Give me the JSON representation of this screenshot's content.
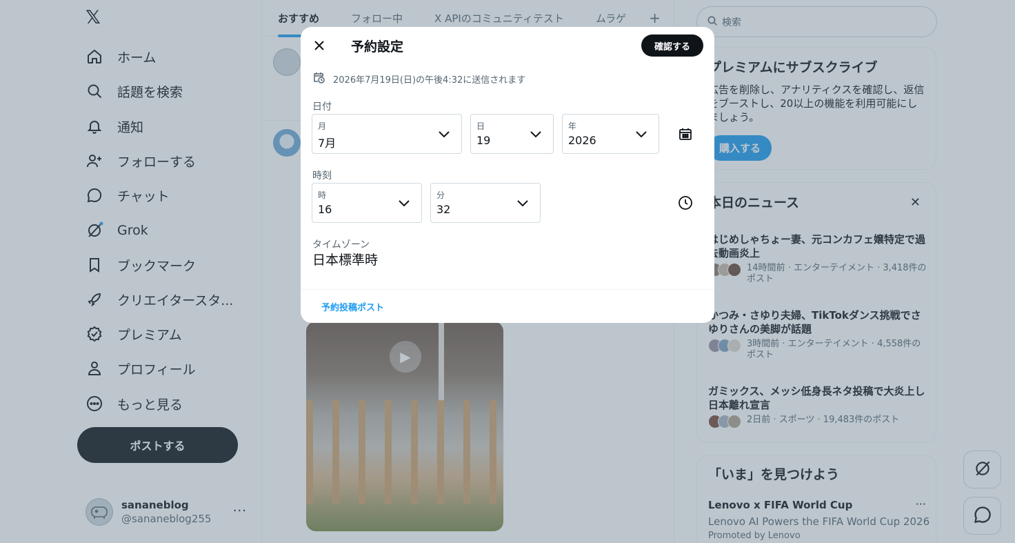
{
  "nav": {
    "items": [
      {
        "label": "ホーム",
        "icon": "home-icon"
      },
      {
        "label": "話題を検索",
        "icon": "search-icon"
      },
      {
        "label": "通知",
        "icon": "bell-icon"
      },
      {
        "label": "フォローする",
        "icon": "person-add-icon"
      },
      {
        "label": "チャット",
        "icon": "chat-icon"
      },
      {
        "label": "Grok",
        "icon": "grok-icon"
      },
      {
        "label": "ブックマーク",
        "icon": "bookmark-icon"
      },
      {
        "label": "クリエイタースタ...",
        "icon": "rocket-icon"
      },
      {
        "label": "プレミアム",
        "icon": "verified-icon"
      },
      {
        "label": "プロフィール",
        "icon": "profile-icon"
      },
      {
        "label": "もっと見る",
        "icon": "more-circle-icon"
      }
    ],
    "post_label": "ポストする"
  },
  "account": {
    "name": "sananeblog",
    "handle": "@sananeblog255"
  },
  "timeline": {
    "tabs": [
      {
        "label": "おすすめ"
      },
      {
        "label": "フォロー中"
      },
      {
        "label": "X APIのコミュニティテスト"
      },
      {
        "label": "ムラゲ"
      }
    ],
    "add_tab": "+"
  },
  "sidebar": {
    "search_placeholder": "検索",
    "premium": {
      "title": "プレミアムにサブスクライブ",
      "body": "広告を削除し、アナリティクスを確認し、返信をブーストし、20以上の機能を利用可能にしましょう。",
      "button": "購入する"
    },
    "news": {
      "title": "本日のニュース",
      "items": [
        {
          "title": "はじめしゃちょー妻、元コンカフェ嬢特定で過去動画炎上",
          "meta": "14時間前 · エンターテイメント · 3,418件のポスト"
        },
        {
          "title": "かつみ・さゆり夫婦、TikTokダンス挑戦でさゆりさんの美脚が話題",
          "meta": "3時間前 · エンターテイメント · 4,558件のポスト"
        },
        {
          "title": "ガミックス、メッシ低身長ネタ投稿で大炎上し日本離れ宣言",
          "meta": "2日前 · スポーツ · 19,483件のポスト"
        }
      ]
    },
    "discover": {
      "title": "「いま」を見つけよう",
      "promo_title": "Lenovo x FIFA World Cup",
      "promo_sub": "Lenovo AI Powers the FIFA World Cup 2026",
      "promo_by": "Promoted by Lenovo"
    }
  },
  "modal": {
    "title": "予約設定",
    "confirm": "確認する",
    "notice": "2026年7月19日(日)の午後4:32に送信されます",
    "date_label": "日付",
    "month": {
      "caption": "月",
      "value": "7月"
    },
    "day": {
      "caption": "日",
      "value": "19"
    },
    "year": {
      "caption": "年",
      "value": "2026"
    },
    "time_label": "時刻",
    "hour": {
      "caption": "時",
      "value": "16"
    },
    "minute": {
      "caption": "分",
      "value": "32"
    },
    "timezone_label": "タイムゾーン",
    "timezone_value": "日本標準時",
    "footer_link": "予約投稿ポスト"
  },
  "colors": {
    "accent": "#1d9bf0",
    "text": "#0f1419",
    "muted": "#536471",
    "border": "#cfd9de"
  }
}
